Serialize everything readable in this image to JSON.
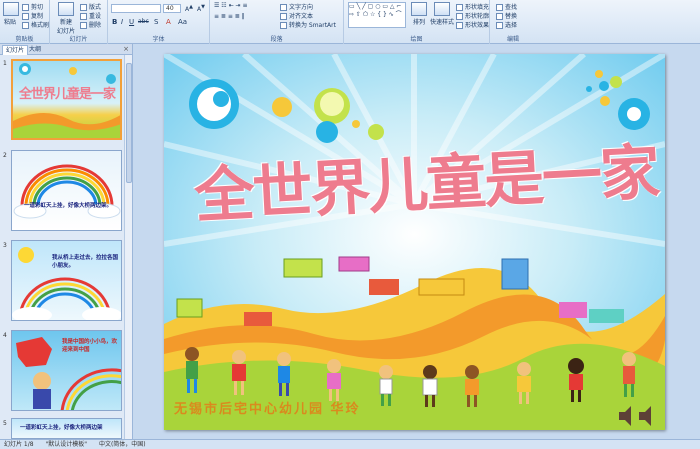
{
  "ribbon": {
    "clipboard": {
      "paste": "粘贴",
      "cut": "剪切",
      "copy": "复制",
      "format_painter": "格式刷",
      "label": "剪贴板"
    },
    "slides": {
      "new_slide": "新建\n幻灯片",
      "layout": "版式",
      "reset": "重设",
      "delete": "删除",
      "label": "幻灯片"
    },
    "font": {
      "font_name": "",
      "font_size": "40",
      "label": "字体",
      "bold": "B",
      "italic": "I",
      "underline": "U",
      "strike": "abc",
      "shadow": "S"
    },
    "paragraph": {
      "label": "段落",
      "text_direction": "文字方向",
      "align_text": "对齐文本",
      "smartart": "转换为 SmartArt"
    },
    "drawing": {
      "label": "绘图",
      "arrange": "排列",
      "quick_styles": "快速样式",
      "shape_fill": "形状填充",
      "shape_outline": "形状轮廓",
      "shape_effects": "形状效果"
    },
    "editing": {
      "label": "编辑",
      "find": "查找",
      "replace": "替换",
      "select": "选择"
    }
  },
  "left_pane": {
    "tab_slides": "幻灯片",
    "tab_outline": "大纲",
    "close": "×",
    "thumbs": [
      {
        "num": "1",
        "title": "全世界儿童是一家"
      },
      {
        "num": "2",
        "text": "一道彩虹天上挂，好像大桥两边架。"
      },
      {
        "num": "3",
        "text": "我从桥上走过去，拉拉各国小朋友。"
      },
      {
        "num": "4",
        "text": "我是中国的小小鸟，欢迎来到中国"
      },
      {
        "num": "5",
        "text": "一道彩虹天上挂，好像大桥两边架"
      }
    ]
  },
  "slide": {
    "title": "全世界儿童是一家",
    "footer": "无锡市后宅中心幼儿园  华玲"
  },
  "status_bar": {
    "slide_info": "幻灯片 1/8",
    "theme": "\"默认设计模板\"",
    "language": "中文(简体，中国)"
  },
  "colors": {
    "sky_top": "#8ed6f2",
    "sky_mid": "#c8ecf7",
    "title_pink": "#ee7c8e",
    "hill_yellow": "#f6c83a",
    "hill_orange": "#f39a2b",
    "hill_green": "#a9d43a",
    "footer_text": "#d98a1e"
  }
}
